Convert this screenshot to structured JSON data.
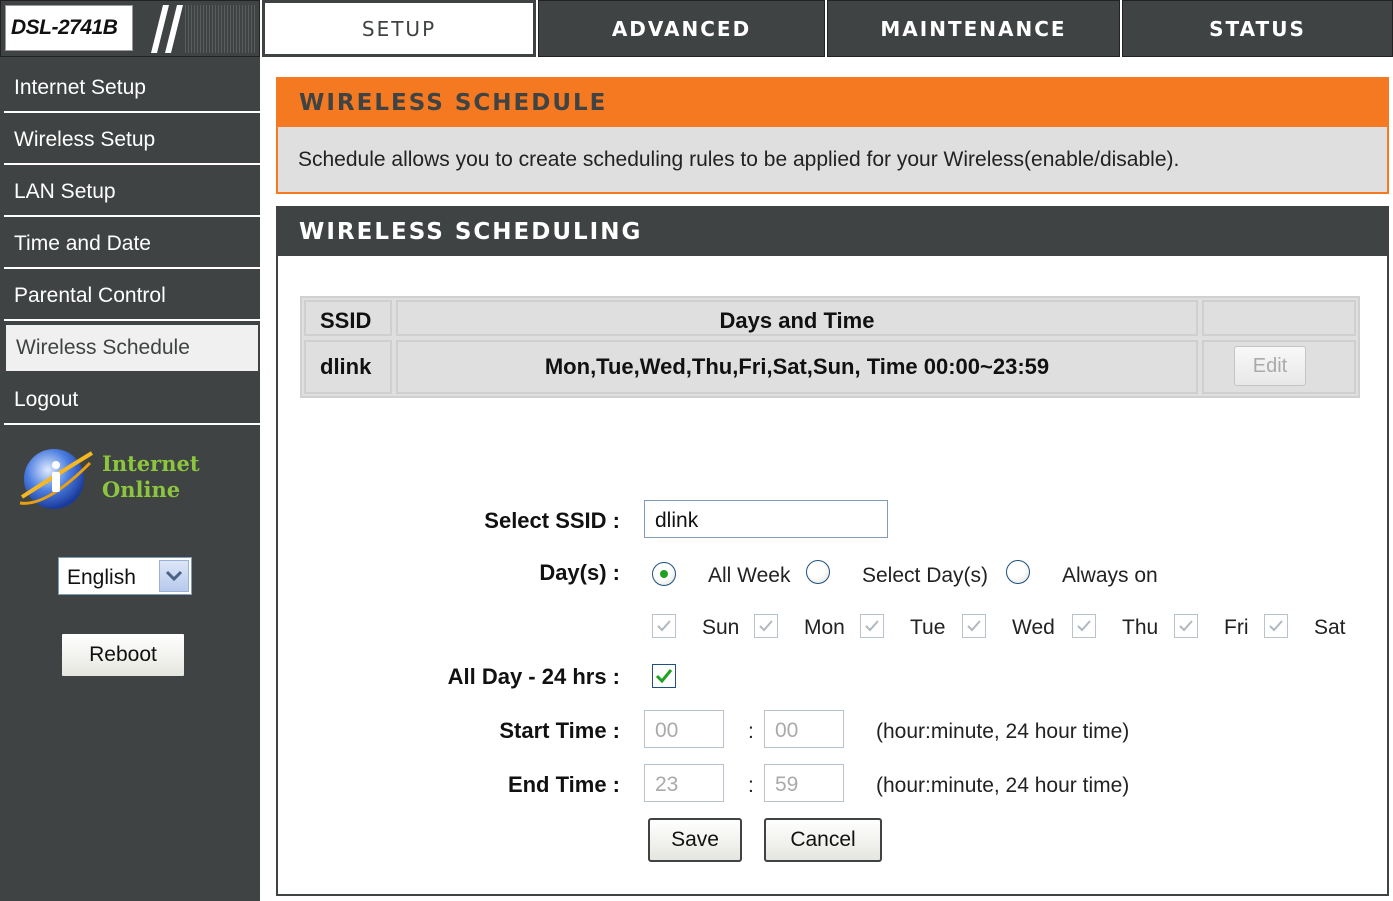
{
  "header": {
    "model": "DSL-2741B",
    "tabs": [
      {
        "label": "SETUP",
        "active": true
      },
      {
        "label": "ADVANCED",
        "active": false
      },
      {
        "label": "MAINTENANCE",
        "active": false
      },
      {
        "label": "STATUS",
        "active": false
      }
    ]
  },
  "sidebar": {
    "items": [
      {
        "label": "Internet Setup",
        "active": false
      },
      {
        "label": "Wireless Setup",
        "active": false
      },
      {
        "label": "LAN Setup",
        "active": false
      },
      {
        "label": "Time and Date",
        "active": false
      },
      {
        "label": "Parental Control",
        "active": false
      },
      {
        "label": "Wireless Schedule",
        "active": true
      },
      {
        "label": "Logout",
        "active": false
      }
    ],
    "status_line1": "Internet",
    "status_line2": "Online",
    "language": "English",
    "reboot_label": "Reboot"
  },
  "schedule_box": {
    "title": "WIRELESS SCHEDULE",
    "description": "Schedule allows you to create scheduling rules to be applied for your Wireless(enable/disable)."
  },
  "scheduling": {
    "title": "WIRELESS SCHEDULING",
    "table": {
      "headers": [
        "SSID",
        "Days and Time",
        ""
      ],
      "rows": [
        {
          "ssid": "dlink",
          "days_time": "Mon,Tue,Wed,Thu,Fri,Sat,Sun, Time 00:00~23:59",
          "action": "Edit"
        }
      ]
    },
    "form": {
      "ssid_label": "Select SSID :",
      "ssid_value": "dlink",
      "days_label": "Day(s) :",
      "day_modes": [
        {
          "label": "All Week",
          "checked": true
        },
        {
          "label": "Select Day(s)",
          "checked": false
        },
        {
          "label": "Always on",
          "checked": false
        }
      ],
      "weekdays": [
        {
          "label": "Sun",
          "checked": true
        },
        {
          "label": "Mon",
          "checked": true
        },
        {
          "label": "Tue",
          "checked": true
        },
        {
          "label": "Wed",
          "checked": true
        },
        {
          "label": "Thu",
          "checked": true
        },
        {
          "label": "Fri",
          "checked": true
        },
        {
          "label": "Sat",
          "checked": true
        }
      ],
      "allday_label": "All Day - 24 hrs :",
      "allday_checked": true,
      "start_label": "Start Time :",
      "start_hour": "00",
      "start_minute": "00",
      "end_label": "End Time :",
      "end_hour": "23",
      "end_minute": "59",
      "colon": ":",
      "time_hint": "(hour:minute, 24 hour time)",
      "save_label": "Save",
      "cancel_label": "Cancel"
    }
  },
  "colors": {
    "header_bg": "#404343",
    "accent_orange": "#f47920",
    "status_green": "#8cc63f",
    "panel_gray": "#dfdfdf"
  }
}
